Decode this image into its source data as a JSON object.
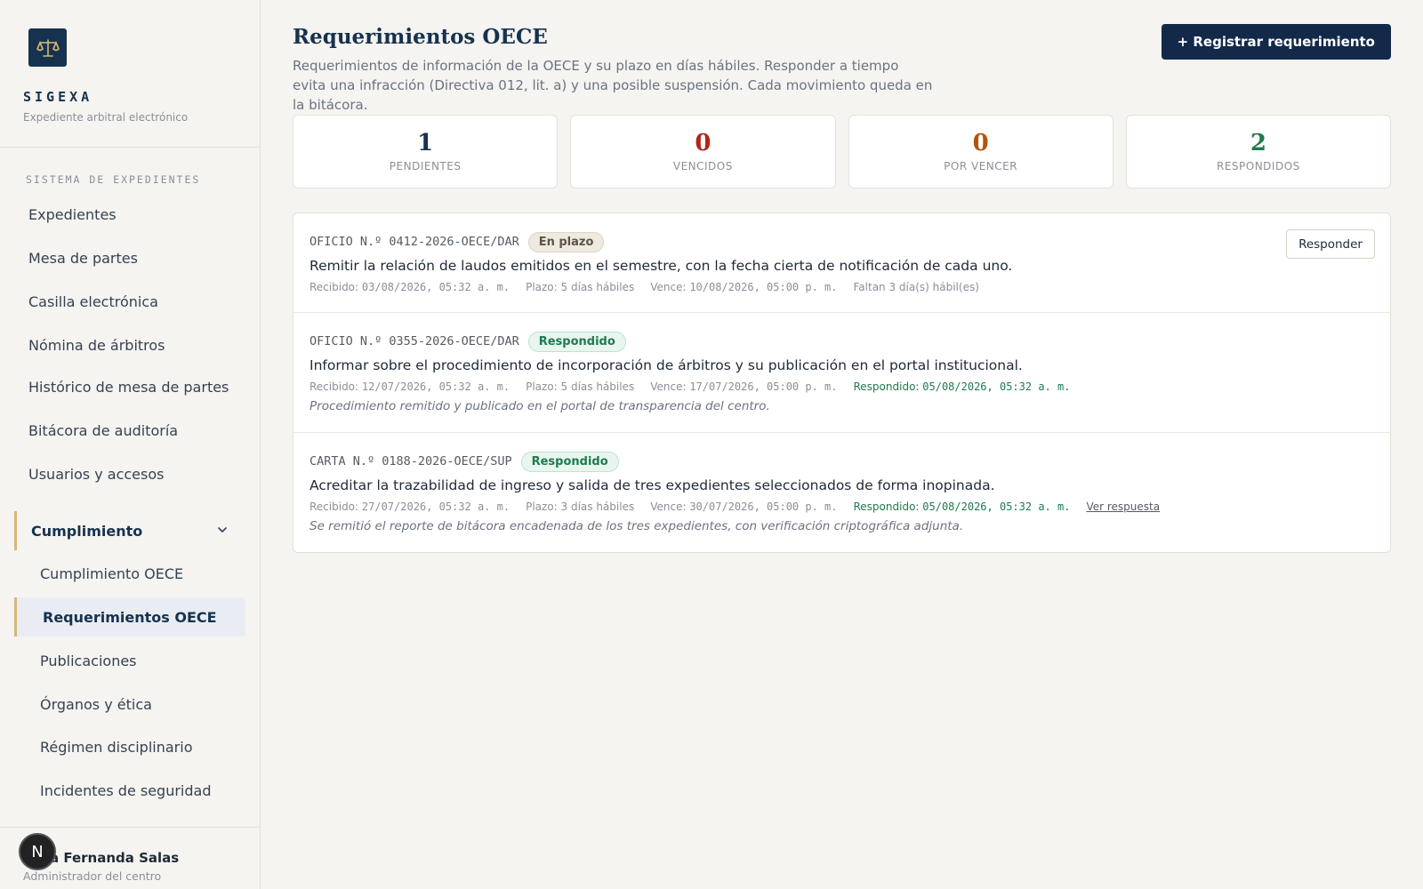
{
  "brand": {
    "name": "SIGEXA",
    "subtitle": "Expediente arbitral electrónico",
    "logo_icon": "scales-icon"
  },
  "sidebar": {
    "section_label": "SISTEMA DE EXPEDIENTES",
    "items": [
      "Expedientes",
      "Mesa de partes",
      "Casilla electrónica",
      "Nómina de árbitros",
      "Histórico de mesa de partes",
      "Bitácora de auditoría",
      "Usuarios y accesos"
    ],
    "group": {
      "label": "Cumplimiento",
      "icon": "chevron-down-icon"
    },
    "sub_items": [
      "Cumplimiento OECE",
      "Requerimientos OECE",
      "Publicaciones",
      "Órganos y ética",
      "Régimen disciplinario",
      "Incidentes de seguridad"
    ],
    "active_item": "Requerimientos OECE"
  },
  "user": {
    "name": "a Fernanda Salas",
    "role": "Administrador del centro",
    "avatar_initial": "N"
  },
  "page": {
    "title": "Requerimientos OECE",
    "description": "Requerimientos de información de la OECE y su plazo en días hábiles. Responder a tiempo evita una infracción (Directiva 012, lit. a) y una posible suspensión. Cada movimiento queda en la bitácora.",
    "primary_button": "+ Registrar requerimiento"
  },
  "stats": [
    {
      "value": "1",
      "label": "PENDIENTES",
      "color": "#16324f"
    },
    {
      "value": "0",
      "label": "VENCIDOS",
      "color": "#b42318"
    },
    {
      "value": "0",
      "label": "POR VENCER",
      "color": "#b45309"
    },
    {
      "value": "2",
      "label": "RESPONDIDOS",
      "color": "#1f7a4d"
    }
  ],
  "requirements": [
    {
      "code": "OFICIO N.º 0412-2026-OECE/DAR",
      "status": "En plazo",
      "text": "Remitir la relación de laudos emitidos en el semestre, con la fecha cierta de notificación de cada uno.",
      "received_label": "Recibido:",
      "received": "03/08/2026, 05:32 a. m.",
      "term": "Plazo: 5 días hábiles",
      "due_label": "Vence:",
      "due": "10/08/2026, 05:00 p. m.",
      "remaining": "Faltan 3 día(s) hábil(es)",
      "action": "Responder"
    },
    {
      "code": "OFICIO N.º 0355-2026-OECE/DAR",
      "status": "Respondido",
      "text": "Informar sobre el procedimiento de incorporación de árbitros y su publicación en el portal institucional.",
      "received_label": "Recibido:",
      "received": "12/07/2026, 05:32 a. m.",
      "term": "Plazo: 5 días hábiles",
      "due_label": "Vence:",
      "due": "17/07/2026, 05:00 p. m.",
      "responded_label": "Respondido:",
      "responded": "05/08/2026, 05:32 a. m.",
      "note": "Procedimiento remitido y publicado en el portal de transparencia del centro."
    },
    {
      "code": "CARTA N.º 0188-2026-OECE/SUP",
      "status": "Respondido",
      "text": "Acreditar la trazabilidad de ingreso y salida de tres expedientes seleccionados de forma inopinada.",
      "received_label": "Recibido:",
      "received": "27/07/2026, 05:32 a. m.",
      "term": "Plazo: 3 días hábiles",
      "due_label": "Vence:",
      "due": "30/07/2026, 05:00 p. m.",
      "responded_label": "Respondido:",
      "responded": "05/08/2026, 05:32 a. m.",
      "link": "Ver respuesta",
      "note": "Se remitió el reporte de bitácora encadenada de los tres expedientes, con verificación criptográfica adjunta."
    }
  ]
}
